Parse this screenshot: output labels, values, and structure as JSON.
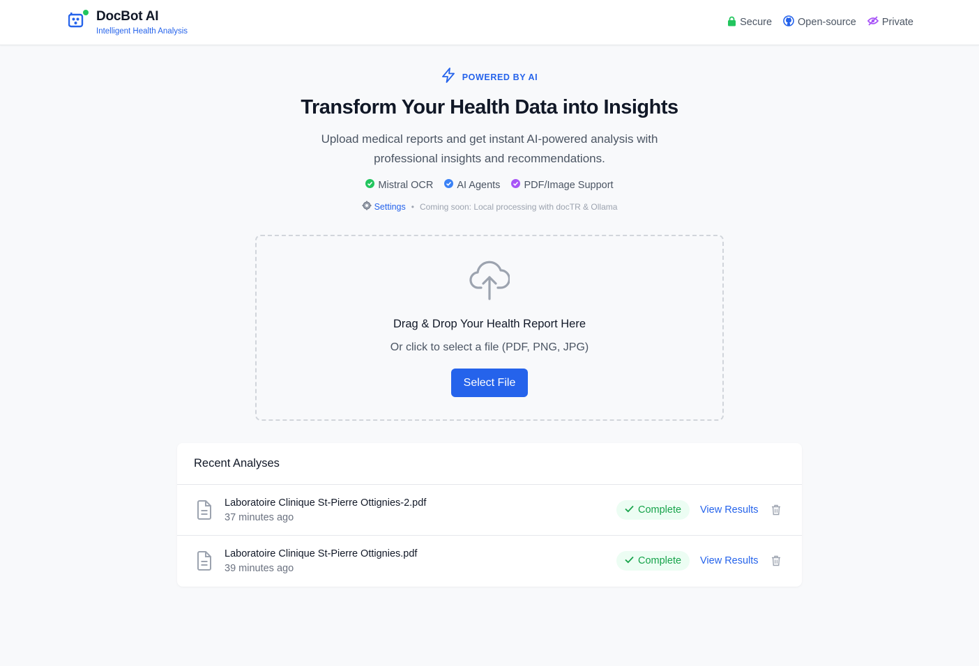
{
  "header": {
    "title": "DocBot AI",
    "subtitle": "Intelligent Health Analysis",
    "badges": [
      {
        "label": "Secure",
        "icon": "lock-icon",
        "color": "#22c55e"
      },
      {
        "label": "Open-source",
        "icon": "github-icon",
        "color": "#2563eb"
      },
      {
        "label": "Private",
        "icon": "eye-off-icon",
        "color": "#a855f7"
      }
    ]
  },
  "hero": {
    "eyebrow": "POWERED BY AI",
    "title": "Transform Your Health Data into Insights",
    "description": "Upload medical reports and get instant AI-powered analysis with professional insights and recommendations.",
    "features": [
      {
        "label": "Mistral OCR",
        "color": "#22c55e"
      },
      {
        "label": "AI Agents",
        "color": "#3b82f6"
      },
      {
        "label": "PDF/Image Support",
        "color": "#a855f7"
      }
    ],
    "settings_label": "Settings",
    "separator": "•",
    "coming_soon": "Coming soon: Local processing with docTR & Ollama"
  },
  "upload": {
    "title": "Drag & Drop Your Health Report Here",
    "subtitle": "Or click to select a file (PDF, PNG, JPG)",
    "button_label": "Select File"
  },
  "recent": {
    "title": "Recent Analyses",
    "items": [
      {
        "name": "Laboratoire Clinique St-Pierre Ottignies-2.pdf",
        "time": "37 minutes ago",
        "status": "Complete",
        "action": "View Results"
      },
      {
        "name": "Laboratoire Clinique St-Pierre Ottignies.pdf",
        "time": "39 minutes ago",
        "status": "Complete",
        "action": "View Results"
      }
    ]
  },
  "colors": {
    "accent": "#2563eb",
    "success": "#16a34a",
    "success_bg": "#ecfdf3",
    "background": "#f8f9fb"
  }
}
